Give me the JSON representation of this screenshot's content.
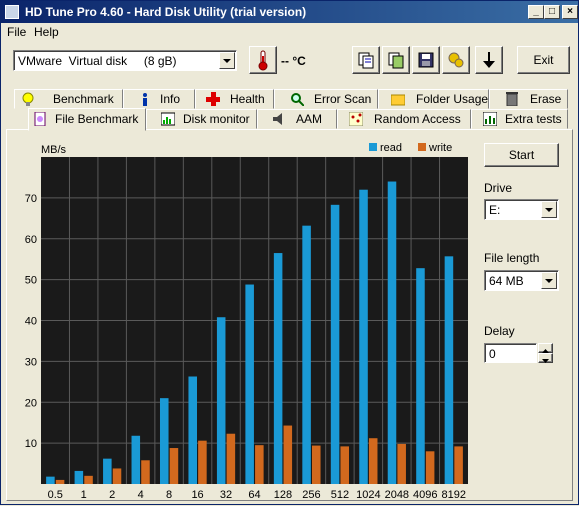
{
  "window": {
    "title": "HD Tune Pro 4.60 - Hard Disk Utility (trial version)",
    "min_label": "_",
    "max_label": "□",
    "close_label": "×"
  },
  "menu": [
    {
      "label": "File"
    },
    {
      "label": "Help"
    }
  ],
  "toolbar": {
    "disk_select": "VMware  Virtual disk     (8 gB)",
    "temperature": "-- °C",
    "exit_label": "Exit",
    "icons": [
      "copy-text-icon",
      "copy-screenshot-icon",
      "save-icon",
      "options-icon",
      "download-icon"
    ]
  },
  "tabs_row1": [
    {
      "label": "Benchmark",
      "icon": "benchmark-icon"
    },
    {
      "label": "Info",
      "icon": "info-icon"
    },
    {
      "label": "Health",
      "icon": "health-icon"
    },
    {
      "label": "Error Scan",
      "icon": "error-scan-icon"
    },
    {
      "label": "Folder Usage",
      "icon": "folder-icon"
    },
    {
      "label": "Erase",
      "icon": "erase-icon"
    }
  ],
  "tabs_row2": [
    {
      "label": "File Benchmark",
      "icon": "file-benchmark-icon",
      "active": true
    },
    {
      "label": "Disk monitor",
      "icon": "disk-monitor-icon"
    },
    {
      "label": "AAM",
      "icon": "aam-icon"
    },
    {
      "label": "Random Access",
      "icon": "random-access-icon"
    },
    {
      "label": "Extra tests",
      "icon": "extra-tests-icon"
    }
  ],
  "controls": {
    "start_label": "Start",
    "drive_label": "Drive",
    "drive_value": "E:",
    "file_length_label": "File length",
    "file_length_value": "64 MB",
    "delay_label": "Delay",
    "delay_value": "0"
  },
  "colors": {
    "read": "#1a9ad6",
    "write": "#d2691e",
    "plot_bg": "#1a1a1a",
    "grid": "#5a5a5a"
  },
  "chart_data": {
    "type": "bar",
    "ylabel": "MB/s",
    "ylim": [
      0,
      80
    ],
    "yticks": [
      10,
      20,
      30,
      40,
      50,
      60,
      70
    ],
    "grid": true,
    "legend_position": "top-right",
    "categories": [
      "0.5",
      "1",
      "2",
      "4",
      "8",
      "16",
      "32",
      "64",
      "128",
      "256",
      "512",
      "1024",
      "2048",
      "4096",
      "8192"
    ],
    "series": [
      {
        "name": "read",
        "values": [
          1.8,
          3.2,
          6.2,
          11.8,
          21,
          26.3,
          40.8,
          48.8,
          56.5,
          63.2,
          68.3,
          72,
          74,
          52.8,
          55.7
        ]
      },
      {
        "name": "write",
        "values": [
          1.0,
          2.0,
          3.8,
          5.8,
          8.8,
          10.6,
          12.3,
          9.5,
          14.3,
          9.4,
          9.2,
          11.2,
          9.8,
          8.0,
          9.2
        ]
      }
    ]
  }
}
